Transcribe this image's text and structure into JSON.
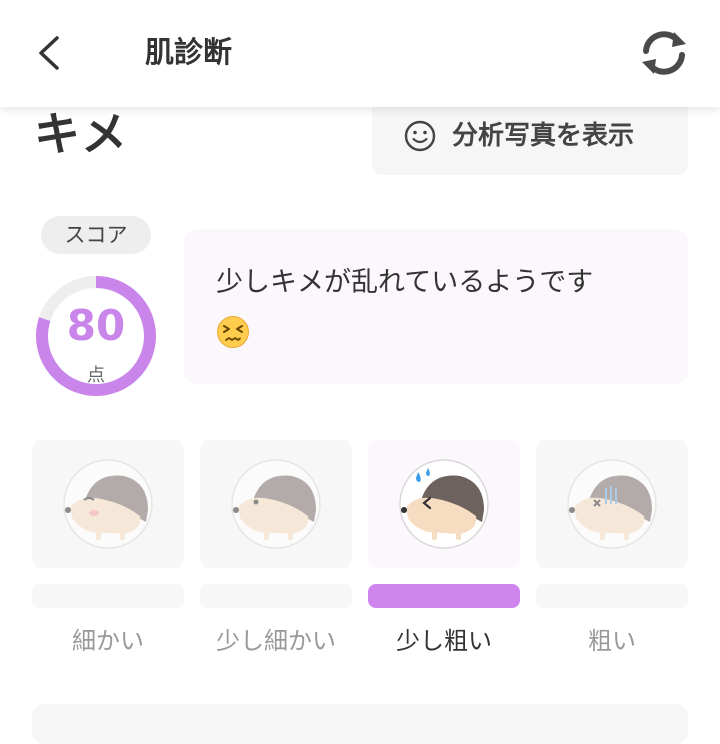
{
  "header": {
    "title": "肌診断",
    "back_icon": "chevron-left-icon",
    "refresh_icon": "refresh-icon"
  },
  "section": {
    "title": "キメ"
  },
  "photo_button": {
    "label": "分析写真を表示",
    "icon": "smile-icon"
  },
  "score": {
    "pill_label": "スコア",
    "value": "80",
    "unit": "点",
    "max": 100,
    "color": "#c985ea"
  },
  "message": {
    "text": "少しキメが乱れているようです",
    "emoji": "persevering-face-emoji"
  },
  "levels": [
    {
      "label": "細かい",
      "icon": "hedgehog-wink-icon",
      "active": false
    },
    {
      "label": "少し細かい",
      "icon": "hedgehog-neutral-icon",
      "active": false
    },
    {
      "label": "少し粗い",
      "icon": "hedgehog-sweat-icon",
      "active": true
    },
    {
      "label": "粗い",
      "icon": "hedgehog-dizzy-icon",
      "active": false
    }
  ],
  "colors": {
    "accent": "#cf84ee",
    "card_bg": "#f7f7f7",
    "active_card_bg": "#fbf7fc"
  }
}
